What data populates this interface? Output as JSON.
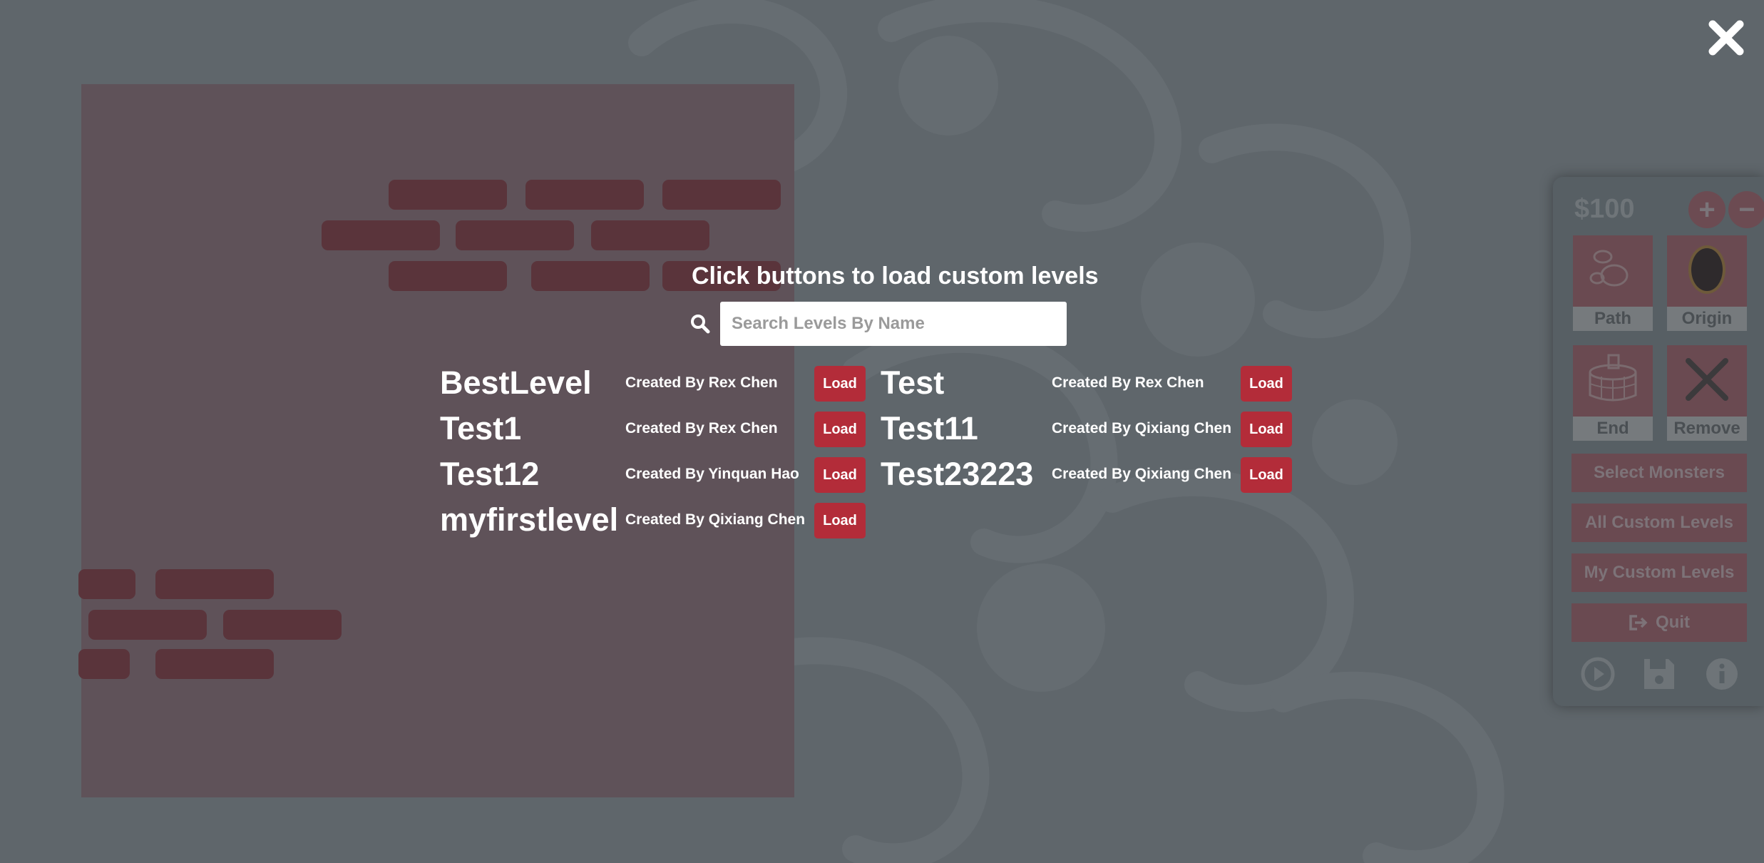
{
  "dialog": {
    "title": "Click buttons to load custom levels",
    "search_placeholder": "Search Levels By Name",
    "search_icon": "search-icon",
    "close_icon": "close-icon"
  },
  "levels": [
    {
      "name": "BestLevel",
      "creator": "Created By Rex Chen",
      "action": "Load"
    },
    {
      "name": "Test",
      "creator": "Created By Rex Chen",
      "action": "Load"
    },
    {
      "name": "Test1",
      "creator": "Created By Rex Chen",
      "action": "Load"
    },
    {
      "name": "Test11",
      "creator": "Created By Qixiang Chen",
      "action": "Load"
    },
    {
      "name": "Test12",
      "creator": "Created By Yinquan Hao",
      "action": "Load"
    },
    {
      "name": "Test23223",
      "creator": "Created By Qixiang Chen",
      "action": "Load"
    },
    {
      "name": "myfirstlevel",
      "creator": "Created By Qixiang Chen",
      "action": "Load"
    }
  ],
  "panel": {
    "currency": "$",
    "money": "100",
    "plus": "+",
    "minus": "−",
    "tools": {
      "path": "Path",
      "origin": "Origin",
      "end": "End",
      "remove": "Remove"
    },
    "select_monsters": "Select Monsters",
    "all_custom_levels": "All Custom Levels",
    "my_custom_levels": "My Custom Levels",
    "quit": "Quit",
    "bottom_icons": [
      "play-icon",
      "save-icon",
      "info-icon"
    ]
  },
  "colors": {
    "background": "#5f666b",
    "canvas": "#5f5259",
    "brick": "#5a343b",
    "load_button": "#b32c39",
    "panel": "#575f64"
  }
}
